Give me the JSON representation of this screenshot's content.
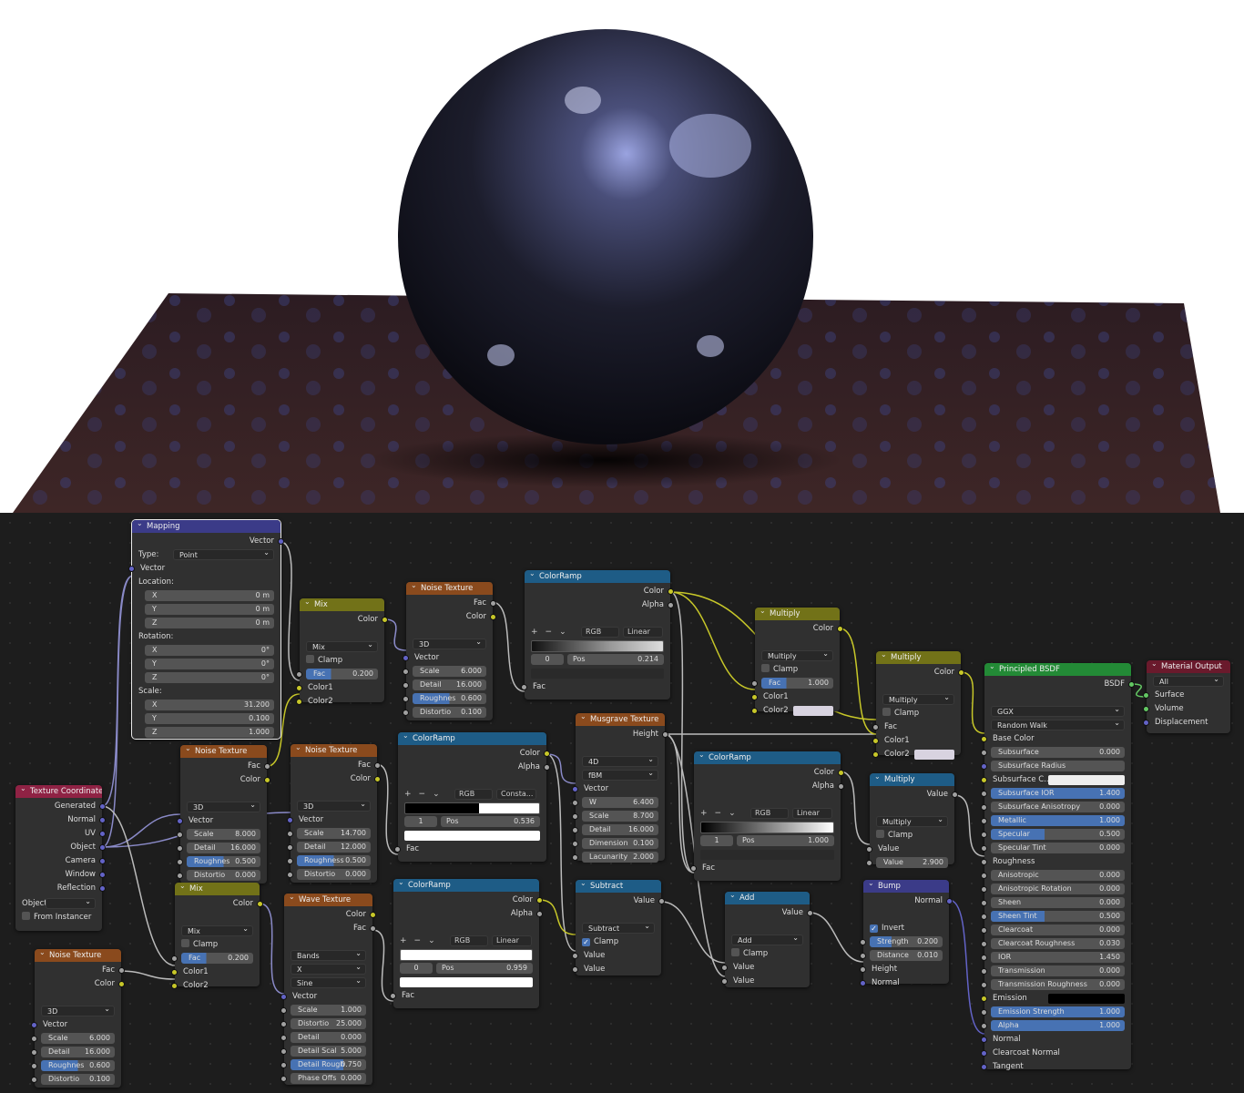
{
  "render": {
    "bg": "#ffffff",
    "floor_color": "#3a2424",
    "sphere_color": "#14172e",
    "highlight": "#8a94d8"
  },
  "nodes": {
    "mapping": {
      "title": "Mapping",
      "out_vector": "Vector",
      "type_label": "Type:",
      "type_value": "Point",
      "in_vector": "Vector",
      "location_label": "Location:",
      "loc": [
        [
          "X",
          "0 m"
        ],
        [
          "Y",
          "0 m"
        ],
        [
          "Z",
          "0 m"
        ]
      ],
      "rotation_label": "Rotation:",
      "rot": [
        [
          "X",
          "0°"
        ],
        [
          "Y",
          "0°"
        ],
        [
          "Z",
          "0°"
        ]
      ],
      "scale_label": "Scale:",
      "scale": [
        [
          "X",
          "31.200"
        ],
        [
          "Y",
          "0.100"
        ],
        [
          "Z",
          "1.000"
        ]
      ]
    },
    "texcoord": {
      "title": "Texture Coordinate",
      "outs": [
        "Generated",
        "Normal",
        "UV",
        "Object",
        "Camera",
        "Window",
        "Reflection"
      ],
      "object_label": "Object",
      "from_instancer": "From Instancer"
    },
    "noise1": {
      "title": "Noise Texture",
      "outs": [
        "Fac",
        "Color"
      ],
      "dim": "3D",
      "in_vector": "Vector",
      "fields": [
        [
          "Scale",
          "6.000"
        ],
        [
          "Detail",
          "16.000"
        ],
        [
          "Roughnes",
          "0.600"
        ],
        [
          "Distortio",
          "0.100"
        ]
      ]
    },
    "noise2": {
      "title": "Noise Texture",
      "outs": [
        "Fac",
        "Color"
      ],
      "dim": "3D",
      "in_vector": "Vector",
      "fields": [
        [
          "Scale",
          "8.000"
        ],
        [
          "Detail",
          "16.000"
        ],
        [
          "Roughnes",
          "0.500"
        ],
        [
          "Distortio",
          "0.000"
        ]
      ]
    },
    "noise3": {
      "title": "Noise Texture",
      "outs": [
        "Fac",
        "Color"
      ],
      "dim": "3D",
      "in_vector": "Vector",
      "fields": [
        [
          "Scale",
          "14.700"
        ],
        [
          "Detail",
          "12.000"
        ],
        [
          "Roughness",
          "0.500"
        ],
        [
          "Distortio",
          "0.000"
        ]
      ]
    },
    "noise4": {
      "title": "Noise Texture",
      "outs": [
        "Fac",
        "Color"
      ],
      "dim": "3D",
      "in_vector": "Vector",
      "fields": [
        [
          "Scale",
          "6.000"
        ],
        [
          "Detail",
          "16.000"
        ],
        [
          "Roughnes",
          "0.600"
        ],
        [
          "Distortio",
          "0.100"
        ]
      ]
    },
    "mix1": {
      "title": "Mix",
      "out": "Color",
      "mode": "Mix",
      "clamp": "Clamp",
      "fac_label": "Fac",
      "fac": "0.200",
      "c1": "Color1",
      "c2": "Color2"
    },
    "mix2": {
      "title": "Mix",
      "out": "Color",
      "mode": "Mix",
      "clamp": "Clamp",
      "fac_label": "Fac",
      "fac": "0.200",
      "c1": "Color1",
      "c2": "Color2"
    },
    "wave": {
      "title": "Wave Texture",
      "outs": [
        "Color",
        "Fac"
      ],
      "type": "Bands",
      "axis": "X",
      "profile": "Sine",
      "in_vector": "Vector",
      "fields": [
        [
          "Scale",
          "1.000"
        ],
        [
          "Distortio",
          "25.000"
        ],
        [
          "Detail",
          "0.000"
        ],
        [
          "Detail Scal",
          "5.000"
        ],
        [
          "Detail Rough",
          "0.750"
        ],
        [
          "Phase Offs",
          "0.000"
        ]
      ]
    },
    "ramp1": {
      "title": "ColorRamp",
      "outs": [
        "Color",
        "Alpha"
      ],
      "mode": "RGB",
      "interp": "Linear",
      "idx": "0",
      "pos_label": "Pos",
      "pos": "0.214",
      "in_fac": "Fac"
    },
    "ramp2": {
      "title": "ColorRamp",
      "outs": [
        "Color",
        "Alpha"
      ],
      "mode": "RGB",
      "interp": "Consta...",
      "idx": "1",
      "pos_label": "Pos",
      "pos": "0.536",
      "in_fac": "Fac"
    },
    "ramp3": {
      "title": "ColorRamp",
      "outs": [
        "Color",
        "Alpha"
      ],
      "mode": "RGB",
      "interp": "Linear",
      "idx": "0",
      "pos_label": "Pos",
      "pos": "0.959",
      "in_fac": "Fac"
    },
    "ramp4": {
      "title": "ColorRamp",
      "outs": [
        "Color",
        "Alpha"
      ],
      "mode": "RGB",
      "interp": "Linear",
      "idx": "1",
      "pos_label": "Pos",
      "pos": "1.000",
      "in_fac": "Fac"
    },
    "musgrave": {
      "title": "Musgrave Texture",
      "out": "Height",
      "dim": "4D",
      "type": "fBM",
      "in_vector": "Vector",
      "fields": [
        [
          "W",
          "6.400"
        ],
        [
          "Scale",
          "8.700"
        ],
        [
          "Detail",
          "16.000"
        ],
        [
          "Dimension",
          "0.100"
        ],
        [
          "Lacunarity",
          "2.000"
        ]
      ]
    },
    "subtract": {
      "title": "Subtract",
      "out": "Value",
      "op": "Subtract",
      "clamp": "Clamp",
      "ins": [
        "Value",
        "Value"
      ]
    },
    "add": {
      "title": "Add",
      "out": "Value",
      "op": "Add",
      "clamp": "Clamp",
      "ins": [
        "Value",
        "Value"
      ]
    },
    "multiply1": {
      "title": "Multiply",
      "out": "Color",
      "mode": "Multiply",
      "clamp": "Clamp",
      "fac_label": "Fac",
      "fac": "1.000",
      "c1": "Color1",
      "c2": "Color2"
    },
    "multiply2": {
      "title": "Multiply",
      "out": "Color",
      "mode": "Multiply",
      "clamp": "Clamp",
      "fac_label": "Fac",
      "c1": "Color1",
      "c2": "Color2"
    },
    "multiply3": {
      "title": "Multiply",
      "out": "Value",
      "op": "Multiply",
      "clamp": "Clamp",
      "in_value": "Value",
      "value_label": "Value",
      "value": "2.900"
    },
    "bump": {
      "title": "Bump",
      "out": "Normal",
      "invert": "Invert",
      "fields": [
        [
          "Strength",
          "0.200"
        ],
        [
          "Distance",
          "0.010"
        ]
      ],
      "ins": [
        "Height",
        "Normal"
      ]
    },
    "bsdf": {
      "title": "Principled BSDF",
      "out": "BSDF",
      "dist": "GGX",
      "sss": "Random Walk",
      "base": "Base Color",
      "rows": [
        [
          "Subsurface",
          "0.000"
        ],
        [
          "Subsurface Radius",
          ""
        ],
        [
          "Subsurface C...",
          ""
        ],
        [
          "Subsurface IOR",
          "1.400"
        ],
        [
          "Subsurface Anisotropy",
          "0.000"
        ],
        [
          "Metallic",
          "1.000"
        ],
        [
          "Specular",
          "0.500"
        ],
        [
          "Specular Tint",
          "0.000"
        ],
        [
          "Roughness",
          ""
        ],
        [
          "Anisotropic",
          "0.000"
        ],
        [
          "Anisotropic Rotation",
          "0.000"
        ],
        [
          "Sheen",
          "0.000"
        ],
        [
          "Sheen Tint",
          "0.500"
        ],
        [
          "Clearcoat",
          "0.000"
        ],
        [
          "Clearcoat Roughness",
          "0.030"
        ],
        [
          "IOR",
          "1.450"
        ],
        [
          "Transmission",
          "0.000"
        ],
        [
          "Transmission Roughness",
          "0.000"
        ],
        [
          "Emission",
          ""
        ],
        [
          "Emission Strength",
          "1.000"
        ],
        [
          "Alpha",
          "1.000"
        ],
        [
          "Normal",
          ""
        ],
        [
          "Clearcoat Normal",
          ""
        ],
        [
          "Tangent",
          ""
        ]
      ]
    },
    "output": {
      "title": "Material Output",
      "target": "All",
      "ins": [
        "Surface",
        "Volume",
        "Displacement"
      ]
    }
  }
}
